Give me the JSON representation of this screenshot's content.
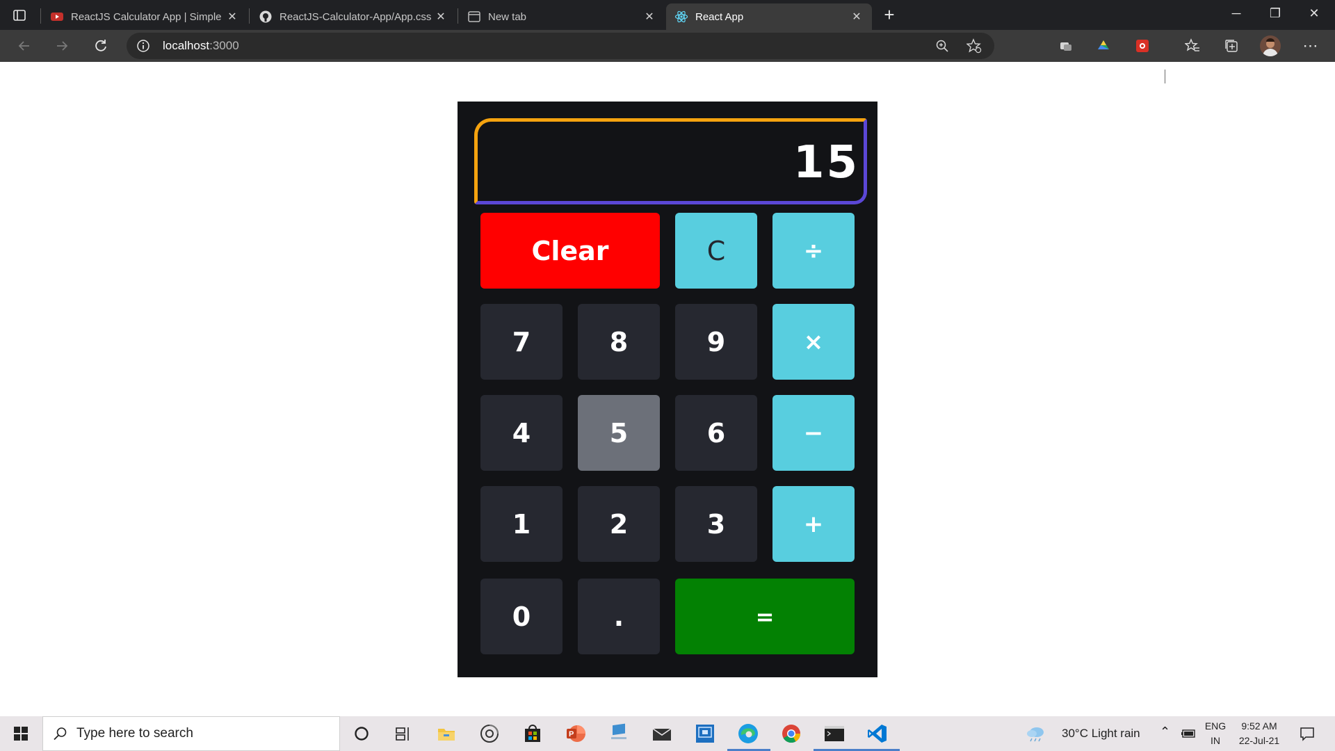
{
  "browser": {
    "tabs": [
      {
        "title": "ReactJS Calculator App | Simple",
        "icon": "youtube-icon"
      },
      {
        "title": "ReactJS-Calculator-App/App.css",
        "icon": "github-icon"
      },
      {
        "title": "New tab",
        "icon": "newtab-icon"
      },
      {
        "title": "React App",
        "icon": "react-icon"
      }
    ],
    "url_host": "localhost",
    "url_port": ":3000",
    "new_tab_symbol": "+",
    "window_controls": {
      "minimize": "─",
      "restore": "❐",
      "close": "✕"
    }
  },
  "calculator": {
    "display": "15",
    "keys": {
      "clear": "Clear",
      "del": "C",
      "divide": "÷",
      "seven": "7",
      "eight": "8",
      "nine": "9",
      "multiply": "×",
      "four": "4",
      "five": "5",
      "six": "6",
      "minus": "−",
      "one": "1",
      "two": "2",
      "three": "3",
      "plus": "+",
      "zero": "0",
      "dot": ".",
      "equals": "="
    },
    "colors": {
      "panel": "#121316",
      "key": "#262830",
      "key_pressed": "#6c7079",
      "operator": "#58cedf",
      "clear": "#ff0000",
      "equals": "#038103",
      "display_border_top": "#f5a30f",
      "display_border_bottom": "#5b47d6"
    }
  },
  "taskbar": {
    "search_placeholder": "Type here to search",
    "weather": "30°C  Light rain",
    "lang_top": "ENG",
    "lang_bottom": "IN",
    "time": "9:52 AM",
    "date": "22-Jul-21"
  }
}
